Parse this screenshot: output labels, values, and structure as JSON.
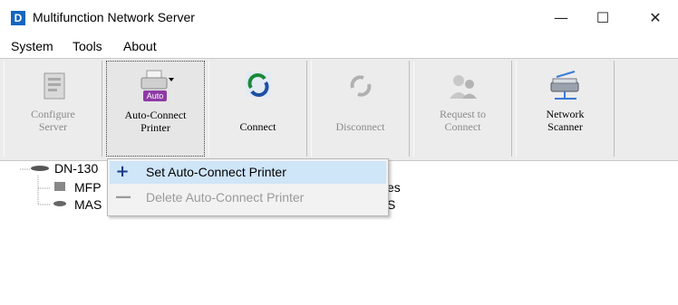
{
  "window": {
    "icon_letter": "D",
    "title": "Multifunction Network Server",
    "minimize": "—",
    "maximize": "☐",
    "close": "✕"
  },
  "menu": [
    "System",
    "Tools",
    "About"
  ],
  "toolbar": {
    "buttons": [
      {
        "label": "Configure\nServer",
        "icon": "configure-server-icon",
        "enabled": false
      },
      {
        "label": "Auto-Connect\nPrinter",
        "icon": "auto-connect-printer-icon",
        "enabled": true,
        "badge": "Auto"
      },
      {
        "label": "Connect",
        "icon": "connect-icon",
        "enabled": true
      },
      {
        "label": "Disconnect",
        "icon": "disconnect-icon",
        "enabled": false
      },
      {
        "label": "Request to\nConnect",
        "icon": "request-connect-icon",
        "enabled": false
      },
      {
        "label": "Network\nScanner",
        "icon": "network-scanner-icon",
        "enabled": true
      }
    ]
  },
  "tree": {
    "root": "DN-130",
    "children": [
      "MFP",
      "MAS"
    ],
    "partial_right": [
      "es",
      "S"
    ]
  },
  "context_menu": {
    "items": [
      {
        "label": "Set Auto-Connect Printer",
        "sign": "+",
        "enabled": true,
        "highlighted": true
      },
      {
        "label": "Delete Auto-Connect Printer",
        "sign": "—",
        "enabled": false,
        "highlighted": false
      }
    ]
  },
  "colors": {
    "accent": "#1565c0",
    "highlight": "#cfe5f8",
    "toolbar": "#ececec"
  }
}
